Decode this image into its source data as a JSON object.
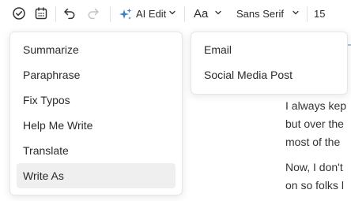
{
  "toolbar": {
    "ai_edit_label": "AI Edit",
    "font_size_label": "Aa",
    "font_family": "Sans Serif",
    "font_size_value": "15",
    "accent_color": "#3b82c4",
    "icons": [
      "check-circle-icon",
      "calendar-icon",
      "undo-icon",
      "redo-icon",
      "sparkles-icon",
      "chevron-down-icon"
    ]
  },
  "ai_menu": {
    "items": [
      {
        "label": "Summarize"
      },
      {
        "label": "Paraphrase"
      },
      {
        "label": "Fix Typos"
      },
      {
        "label": "Help Me Write"
      },
      {
        "label": "Translate"
      },
      {
        "label": "Write As",
        "selected": true
      }
    ]
  },
  "write_as_menu": {
    "items": [
      {
        "label": "Email"
      },
      {
        "label": "Social Media Post"
      }
    ]
  },
  "editor": {
    "lines": [
      "I always kep",
      "but over the",
      "most of the",
      "Now, I don't",
      "on so folks l"
    ]
  }
}
